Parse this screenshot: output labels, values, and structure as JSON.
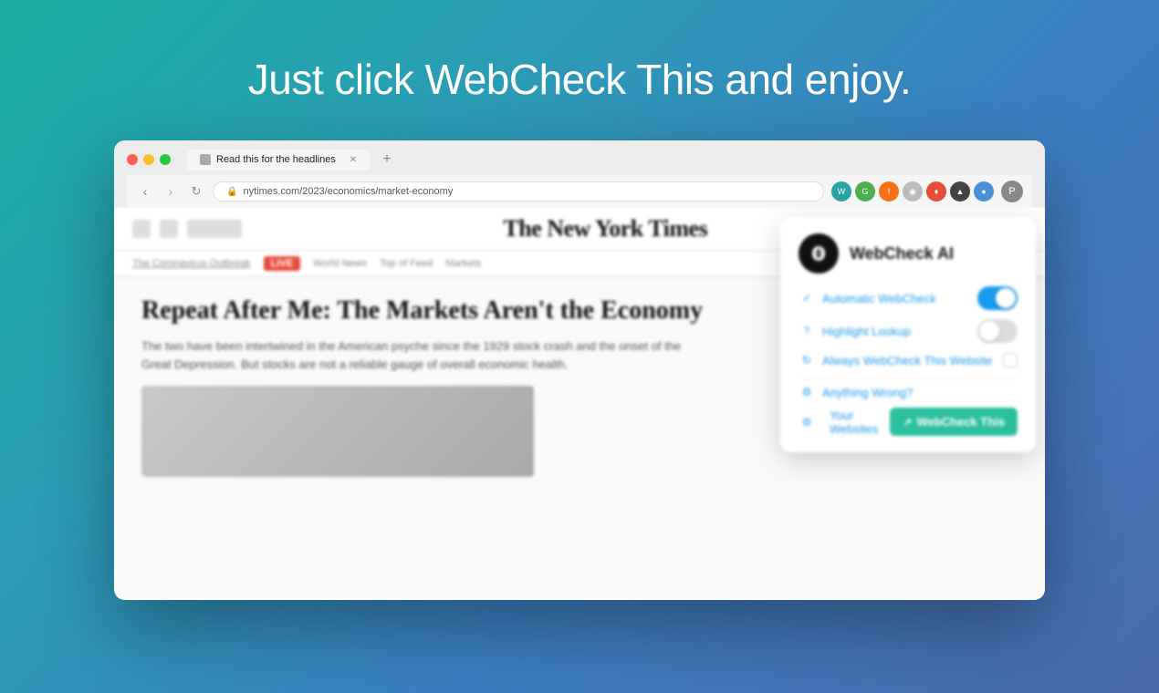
{
  "headline": {
    "prefix": "Just click ",
    "brand": "WebCheck This",
    "suffix": " and enjoy."
  },
  "browser": {
    "tab_title": "Read this for the headlines",
    "address": "nytimes.com/2023/economics/market-economy",
    "toolbar_buttons": [
      "←",
      "→",
      "↻"
    ]
  },
  "nyt": {
    "title": "The New York Times",
    "subnav_items": [
      "The Coronavirus Outbreak",
      "LIVE",
      "World News",
      "Top of Feed"
    ],
    "article_title": "Repeat After Me: The Markets Aren't the Economy",
    "article_body1": "The two have been intertwined in the American psyche since the 1929 stock crash and the onset of the Great Depression. But stocks are not a reliable gauge of overall economic health."
  },
  "popup": {
    "title": "WebCheck AI",
    "rows": [
      {
        "icon": "✓",
        "label": "Automatic WebCheck",
        "control": "toggle-on"
      },
      {
        "icon": "?",
        "label": "Highlight Lookup",
        "control": "toggle-off"
      },
      {
        "icon": "⟳",
        "label": "Always WebCheck This Website",
        "control": "checkbox"
      },
      {
        "icon": "⚙",
        "label": "Anything Wrong?",
        "control": "none"
      },
      {
        "icon": "⚙",
        "label": "Your Websites",
        "control": "none"
      }
    ],
    "button_label": "WebCheck This",
    "button_icon": "↗"
  },
  "colors": {
    "accent_teal": "#2bbf9f",
    "accent_blue": "#1a9aef",
    "toggle_on": "#1a9aef",
    "toggle_off": "#ddd",
    "bg_gradient_start": "#1aada0",
    "bg_gradient_end": "#4a6aad"
  }
}
